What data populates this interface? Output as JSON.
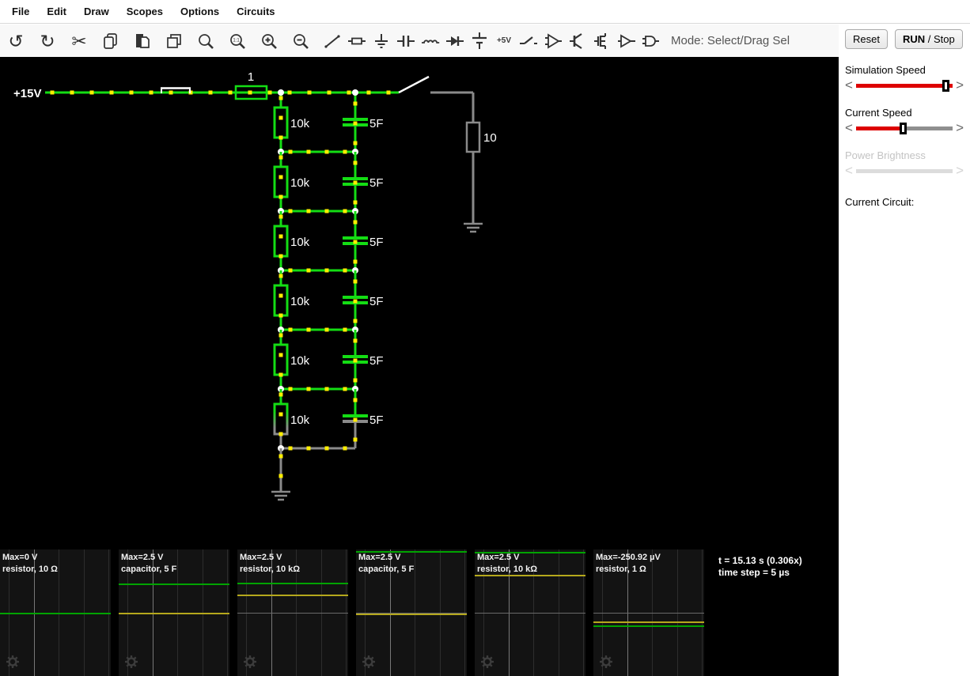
{
  "menu": {
    "items": [
      "File",
      "Edit",
      "Draw",
      "Scopes",
      "Options",
      "Circuits"
    ]
  },
  "toolbar": {
    "mode_label": "Mode: Select/Drag Sel",
    "plus5v_label": "+5V",
    "icons": [
      "undo",
      "redo",
      "cut",
      "copy",
      "paste",
      "duplicate",
      "find",
      "zoom-100",
      "zoom-in",
      "zoom-out",
      "wire",
      "resistor",
      "ground",
      "capacitor",
      "inductor",
      "diode",
      "voltage-source",
      "plus-5v",
      "switch",
      "op-amp",
      "transistor",
      "mosfet",
      "buffer",
      "and-gate"
    ]
  },
  "side_panel": {
    "reset_label": "Reset",
    "run_strong": "RUN",
    "run_rest": " / Stop",
    "sliders": [
      {
        "label": "Simulation Speed",
        "fill_pct": 100,
        "thumb_pct": 93,
        "enabled": true
      },
      {
        "label": "Current Speed",
        "fill_pct": 48,
        "thumb_pct": 48,
        "enabled": true
      },
      {
        "label": "Power Brightness",
        "fill_pct": 0,
        "thumb_pct": null,
        "enabled": false
      }
    ],
    "current_circuit_label": "Current Circuit:"
  },
  "circuit": {
    "labels": {
      "source": "+15V",
      "series_resistor": "1",
      "load_resistor": "10"
    },
    "stages": [
      {
        "resistor": "10k",
        "capacitor": "5F"
      },
      {
        "resistor": "10k",
        "capacitor": "5F"
      },
      {
        "resistor": "10k",
        "capacitor": "5F"
      },
      {
        "resistor": "10k",
        "capacitor": "5F"
      },
      {
        "resistor": "10k",
        "capacitor": "5F"
      },
      {
        "resistor": "10k",
        "capacitor": "5F"
      }
    ],
    "colors": {
      "energized": "#14dd14",
      "neutral": "#8a8a8a",
      "current_dot": "#ffee00",
      "switch_blade": "#ffffff",
      "junction": "#ffffff",
      "label": "#ffffff"
    }
  },
  "scopes": [
    {
      "max": "Max=0 V",
      "component": "resistor, 10 Ω",
      "traces": [
        {
          "color": "green",
          "y": 80
        }
      ]
    },
    {
      "max": "Max=2.5 V",
      "component": "capacitor, 5 F",
      "traces": [
        {
          "color": "green",
          "y": 43
        },
        {
          "color": "yellow",
          "y": 80
        }
      ]
    },
    {
      "max": "Max=2.5 V",
      "component": "resistor, 10 kΩ",
      "traces": [
        {
          "color": "green",
          "y": 42
        },
        {
          "color": "yellow",
          "y": 57
        }
      ]
    },
    {
      "max": "Max=2.5 V",
      "component": "capacitor, 5 F",
      "traces": [
        {
          "color": "green",
          "y": 2
        },
        {
          "color": "yellow",
          "y": 81
        }
      ]
    },
    {
      "max": "Max=2.5 V",
      "component": "resistor, 10 kΩ",
      "traces": [
        {
          "color": "green",
          "y": 3
        },
        {
          "color": "yellow",
          "y": 32
        }
      ]
    },
    {
      "max": "Max=-250.92 µV",
      "component": "resistor, 1 Ω",
      "traces": [
        {
          "color": "yellow",
          "y": 91
        },
        {
          "color": "green",
          "y": 96
        }
      ]
    }
  ],
  "status": {
    "time": "t = 15.13 s (0.306x)",
    "step": "time step = 5 µs"
  },
  "colors": {
    "slider_red": "#dd0000",
    "scope_green": "#00a300",
    "scope_yellow": "#b5a81c",
    "canvas_bg": "#000000"
  }
}
